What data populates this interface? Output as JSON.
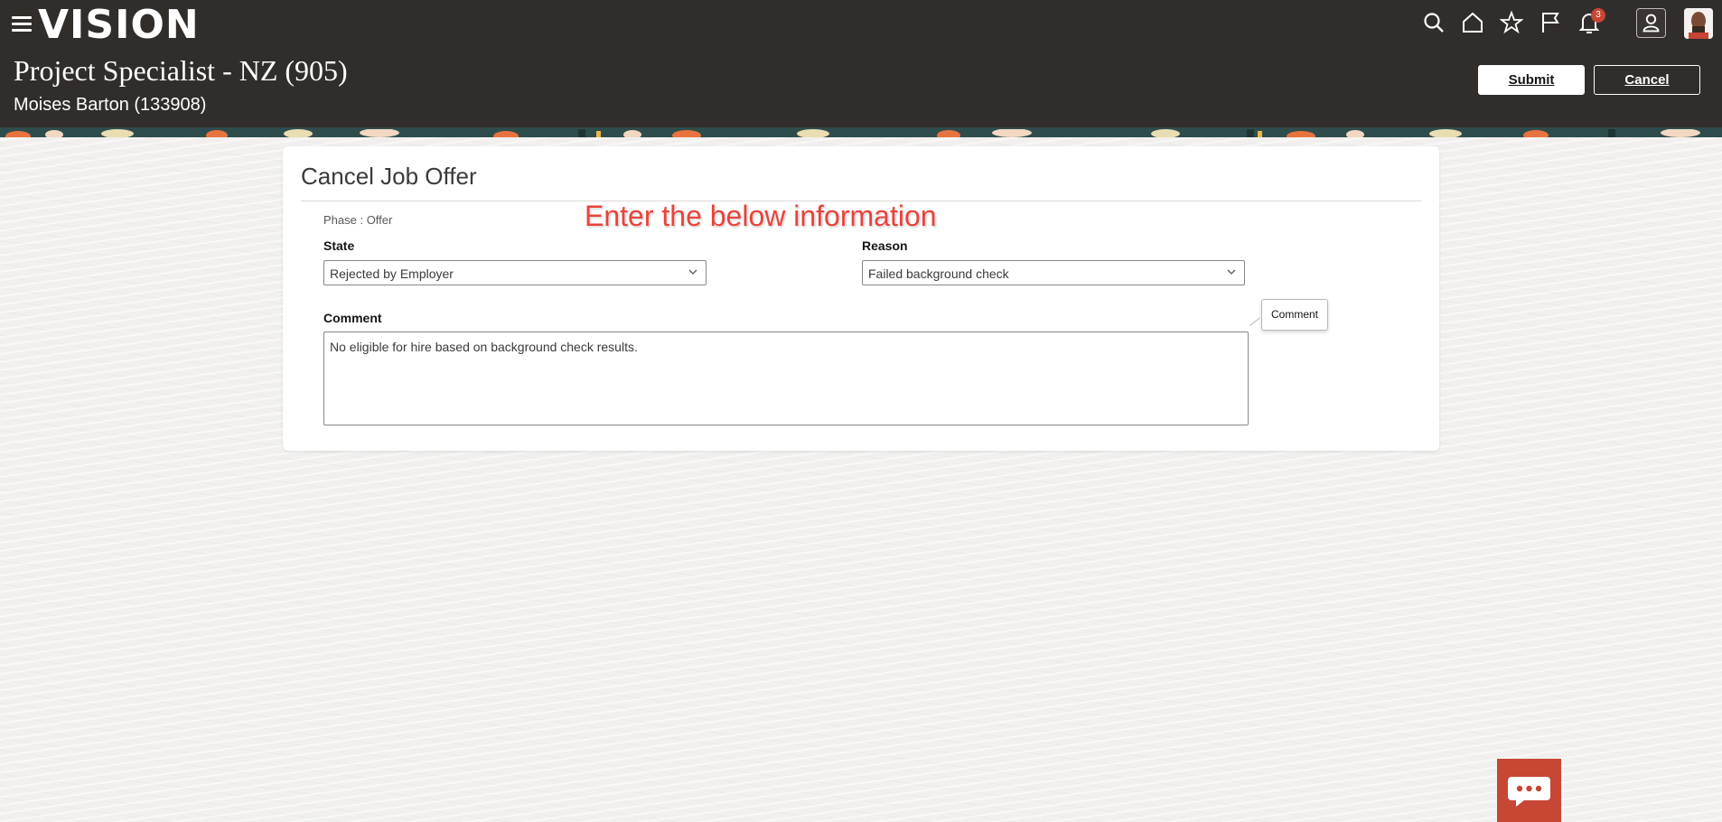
{
  "header": {
    "logo": "VISION",
    "title": "Project Specialist - NZ (905)",
    "subtitle": "Moises Barton (133908)",
    "notification_count": "3",
    "submit_label": "Submit",
    "cancel_label": "Cancel",
    "icons": [
      "menu-icon",
      "search-icon",
      "home-icon",
      "star-icon",
      "flag-icon",
      "bell-icon",
      "user-icon"
    ]
  },
  "card": {
    "title": "Cancel Job Offer",
    "phase": "Phase : Offer",
    "state": {
      "label": "State",
      "value": "Rejected by Employer"
    },
    "reason": {
      "label": "Reason",
      "value": "Failed background check"
    },
    "comment": {
      "label": "Comment",
      "value": "No eligible for hire based on background check results.",
      "tooltip": "Comment"
    }
  },
  "annotation": "Enter the below information",
  "colors": {
    "header_bg": "#312d2a",
    "page_bg": "#f1f0ee",
    "annotation": "#e8433c",
    "chat_bg": "#c74634"
  }
}
